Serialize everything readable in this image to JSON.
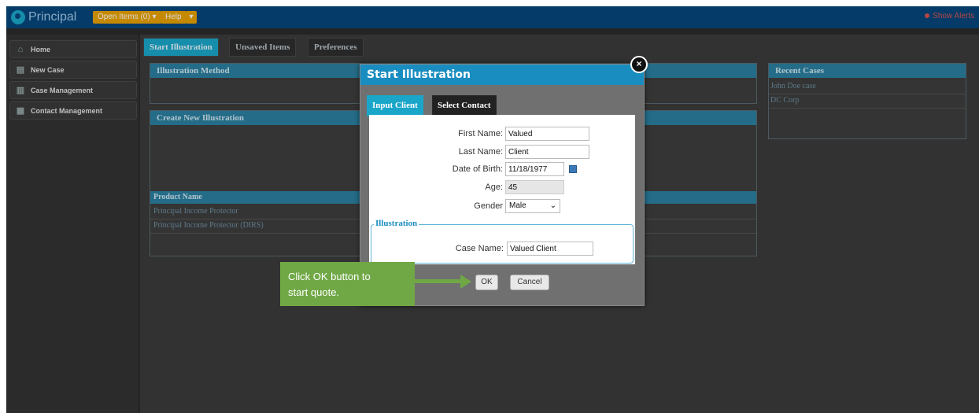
{
  "app": {
    "logo_text": "Principal",
    "open_items_label": "Open Items (0)",
    "help_label": "Help",
    "alerts_label": "Show Alerts"
  },
  "colors": {
    "brand_blue": "#06467c",
    "accent_teal": "#1aa6c9",
    "callout_green": "#70a846"
  },
  "nav": {
    "items": [
      {
        "label": "Home",
        "icon": "home-icon"
      },
      {
        "label": "New Case",
        "icon": "new-case-icon"
      },
      {
        "label": "Case Management",
        "icon": "case-management-icon"
      },
      {
        "label": "Contact Management",
        "icon": "contact-management-icon"
      }
    ]
  },
  "tabs": [
    "Start Illustration",
    "Unsaved Items",
    "Preferences"
  ],
  "panels": {
    "illustration_method": "Illustration Method",
    "create_new_illustration": "Create New Illustration",
    "product_name_header": "Product Name",
    "products": [
      "Principal Income Protector",
      "Principal Income Protector (DIRS)"
    ],
    "recent_cases_title": "Recent Cases",
    "recent_cases": [
      "John Doe case",
      "DC Corp"
    ]
  },
  "modal": {
    "title": "Start Illustration",
    "tabs": [
      "Input Client",
      "Select Contact"
    ],
    "fields": {
      "first_name_label": "First Name:",
      "first_name_value": "Valued",
      "last_name_label": "Last Name:",
      "last_name_value": "Client",
      "dob_label": "Date of Birth:",
      "dob_value": "11/18/1977",
      "age_label": "Age:",
      "age_value": "45",
      "gender_label": "Gender",
      "gender_value": "Male"
    },
    "illustration_legend": "Illustration",
    "case_name_label": "Case Name:",
    "case_name_value": "Valued Client",
    "ok_label": "OK",
    "cancel_label": "Cancel"
  },
  "callout": {
    "line1": "Click OK button to",
    "line2": "start quote."
  }
}
